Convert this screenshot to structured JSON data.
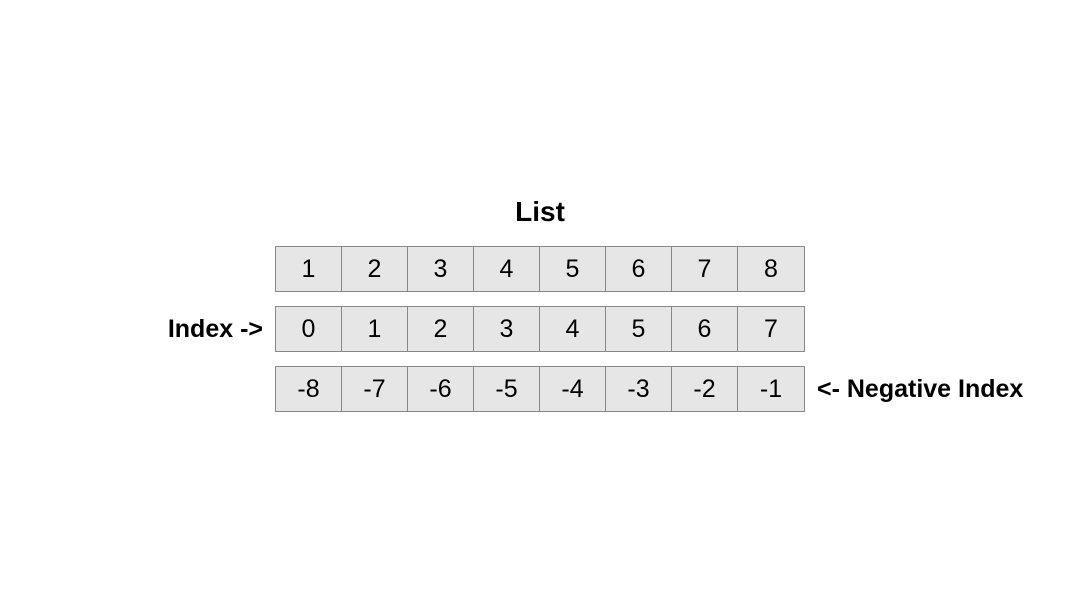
{
  "title": "List",
  "rows": {
    "values": [
      "1",
      "2",
      "3",
      "4",
      "5",
      "6",
      "7",
      "8"
    ],
    "positive": [
      "0",
      "1",
      "2",
      "3",
      "4",
      "5",
      "6",
      "7"
    ],
    "negative": [
      "-8",
      "-7",
      "-6",
      "-5",
      "-4",
      "-3",
      "-2",
      "-1"
    ]
  },
  "labels": {
    "index": "Index ->",
    "negative_index": "<- Negative Index"
  }
}
